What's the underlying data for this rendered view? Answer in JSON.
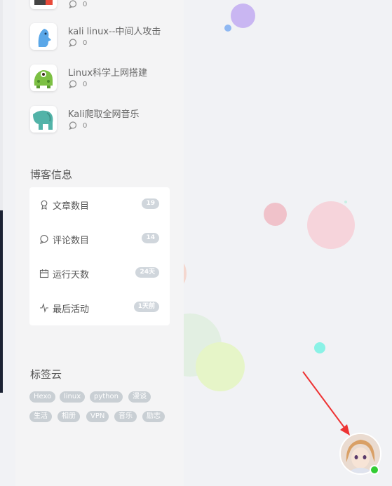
{
  "recent_posts": [
    {
      "title": "",
      "comments": "0"
    },
    {
      "title": "kali linux--中间人攻击",
      "comments": "0"
    },
    {
      "title": "Linux科学上网搭建",
      "comments": "0"
    },
    {
      "title": "Kali爬取全网音乐",
      "comments": "0"
    }
  ],
  "blog_info": {
    "title": "博客信息",
    "rows": [
      {
        "label": "文章数目",
        "value": "19",
        "icon": "award-icon"
      },
      {
        "label": "评论数目",
        "value": "14",
        "icon": "comment-icon"
      },
      {
        "label": "运行天数",
        "value": "24天",
        "icon": "calendar-icon"
      },
      {
        "label": "最后活动",
        "value": "1天前",
        "icon": "activity-icon"
      }
    ]
  },
  "tag_cloud": {
    "title": "标签云",
    "tags": [
      "Hexo",
      "linux",
      "python",
      "漫谈",
      "生活",
      "相册",
      "VPN",
      "音乐",
      "励志"
    ]
  },
  "colors": {
    "sidebar_bg": "#f4f4f5",
    "badge_bg": "#d0d6dc",
    "tag_bg": "#c9cfd4",
    "status_online": "#33cc33",
    "annotation_arrow": "#ee3333"
  }
}
